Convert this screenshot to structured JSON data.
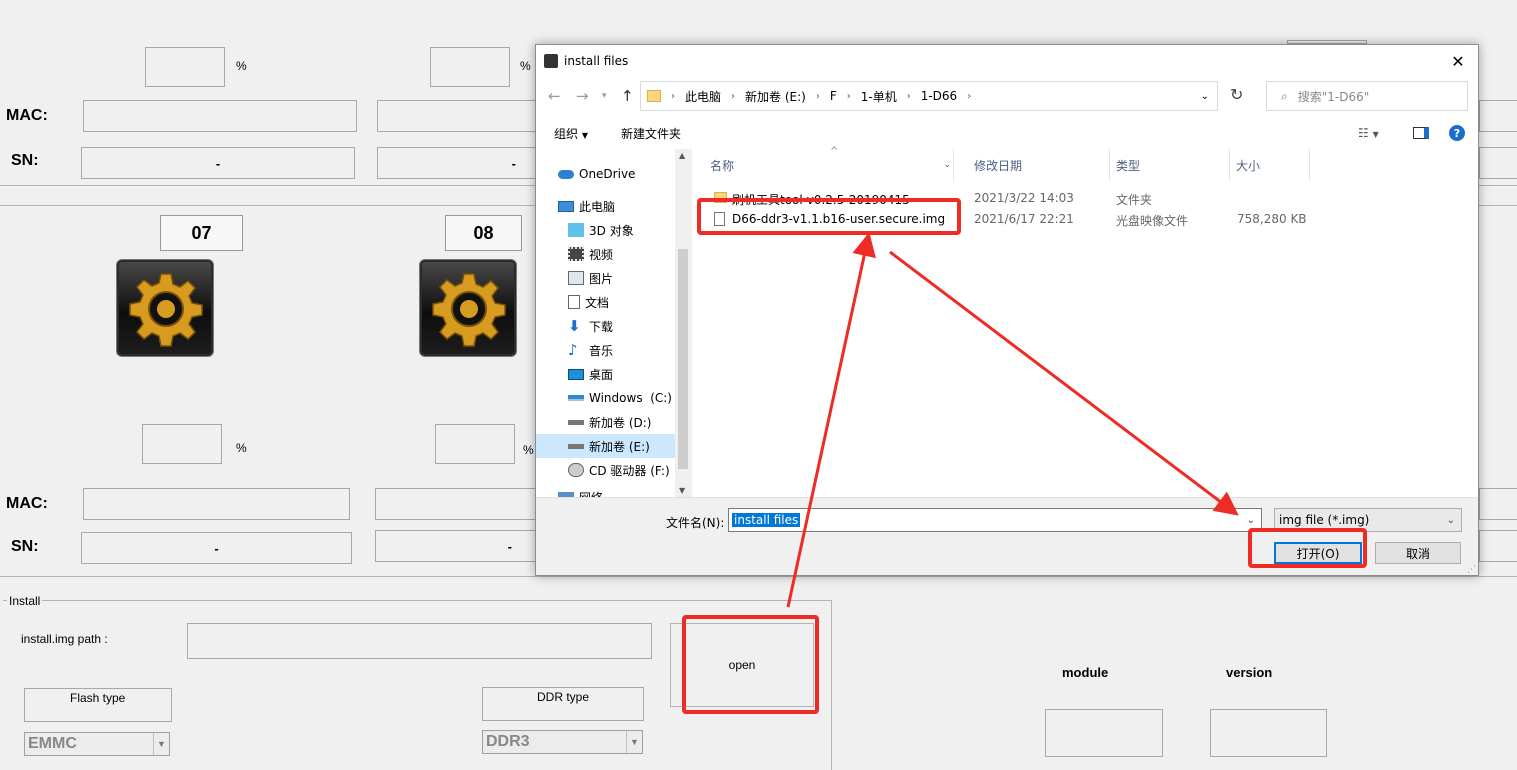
{
  "background": {
    "pct": "%",
    "mac_label": "MAC:",
    "sn_label": "SN:",
    "dash": "-",
    "slots": [
      {
        "num": "07"
      },
      {
        "num": "08"
      }
    ],
    "install_group": "Install",
    "img_path_label": "install.img path :",
    "open_button": "open",
    "flash_type_label": "Flash type",
    "flash_type_value": "EMMC",
    "ddr_type_label": "DDR type",
    "ddr_type_value": "DDR3",
    "module_label": "module",
    "version_label": "version"
  },
  "dialog": {
    "title": "install files",
    "close": "✕",
    "breadcrumb": [
      "此电脑",
      "新加卷 (E:)",
      "F",
      "1-单机",
      "1-D66"
    ],
    "search_placeholder": "搜索\"1-D66\"",
    "organize": "组织",
    "new_folder": "新建文件夹",
    "help": "?",
    "nav": [
      {
        "label": "OneDrive",
        "icon": "cloud-icon"
      },
      {
        "label": "此电脑",
        "icon": "computer-icon"
      },
      {
        "label": "3D 对象",
        "icon": "cube-icon"
      },
      {
        "label": "视频",
        "icon": "video-icon"
      },
      {
        "label": "图片",
        "icon": "picture-icon"
      },
      {
        "label": "文档",
        "icon": "document-icon"
      },
      {
        "label": "下载",
        "icon": "download-icon"
      },
      {
        "label": "音乐",
        "icon": "music-icon"
      },
      {
        "label": "桌面",
        "icon": "desktop-icon"
      },
      {
        "label": "Windows  (C:)",
        "icon": "drive-icon"
      },
      {
        "label": "新加卷 (D:)",
        "icon": "drive-icon"
      },
      {
        "label": "新加卷 (E:)",
        "icon": "drive-icon"
      },
      {
        "label": "CD 驱动器 (F:)",
        "icon": "cd-drive-icon"
      },
      {
        "label": "网络",
        "icon": "network-icon"
      }
    ],
    "columns": {
      "name": "名称",
      "date": "修改日期",
      "type": "类型",
      "size": "大小"
    },
    "files": [
      {
        "name": "刷机工具tool-v0.2.5-20190415",
        "date": "2021/3/22 14:03",
        "type": "文件夹",
        "size": ""
      },
      {
        "name": "D66-ddr3-v1.1.b16-user.secure.img",
        "date": "2021/6/17 22:21",
        "type": "光盘映像文件",
        "size": "758,280 KB"
      }
    ],
    "filename_label": "文件名(N):",
    "filename_value": "install files",
    "filter_value": "img file (*.img)",
    "open_button": "打开(O)",
    "cancel_button": "取消"
  },
  "colors": {
    "annotation_red": "#ee2b24",
    "selection_blue": "#0078d7"
  }
}
